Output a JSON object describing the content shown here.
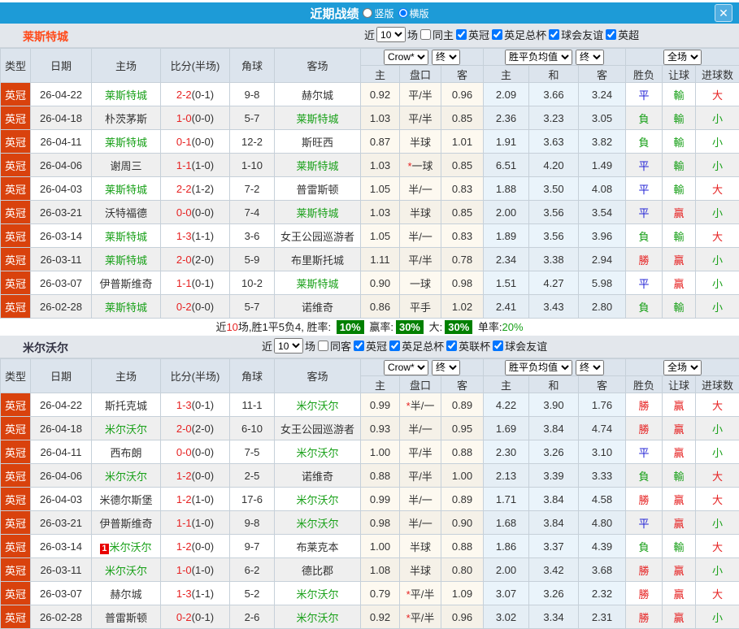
{
  "titlebar": {
    "title": "近期战绩",
    "radio_options": [
      {
        "label": "竖版",
        "selected": false
      },
      {
        "label": "横版",
        "selected": true
      }
    ],
    "close_glyph": "✕"
  },
  "table_header": {
    "type": "类型",
    "date": "日期",
    "home": "主场",
    "score": "比分(半场)",
    "corner": "角球",
    "away": "客场",
    "dd_company": "Crow*",
    "dd_final": "终",
    "dd_avg": "胜平负均值",
    "dd_final2": "终",
    "dd_scope": "全场",
    "sub_home": "主",
    "sub_handicap": "盘口",
    "sub_away": "客",
    "sub_win": "主",
    "sub_draw": "和",
    "sub_lose": "客",
    "sub_wl": "胜负",
    "sub_let": "让球",
    "sub_goals": "进球数"
  },
  "colors": {
    "red": "#e62222",
    "blue": "#2323d6",
    "green": "#18a018",
    "team_green": "#18a018",
    "league_badge_bg": "#d9420d",
    "title_bg": "#1d9bd7",
    "badge_green_bg": "#008000"
  },
  "result_map": {
    "勝": "red",
    "平": "blue",
    "負": "green",
    "贏": "red",
    "輸": "green",
    "大": "red",
    "小": "green"
  },
  "sections": [
    {
      "team": "莱斯特城",
      "team_color": "#ff4a1a",
      "filter": {
        "near": "近",
        "count": "10",
        "games": "场",
        "same": "同主",
        "same_checked": false,
        "leagues": [
          "英冠",
          "英足总杯",
          "球会友谊",
          "英超"
        ],
        "leagues_checked": [
          true,
          true,
          true,
          true
        ]
      },
      "rows": [
        {
          "lg": "英冠",
          "dt": "26-04-22",
          "hm": "莱斯特城",
          "hg": true,
          "sc": "2-2",
          "hf": "(0-1)",
          "cn": "9-8",
          "aw": "赫尔城",
          "ag": false,
          "o1": "0.92",
          "st": false,
          "hc": "平/半",
          "o2": "0.96",
          "ow": "2.09",
          "od": "3.66",
          "ol": "3.24",
          "r1": "平",
          "r2": "輸",
          "r3": "大"
        },
        {
          "lg": "英冠",
          "dt": "26-04-18",
          "hm": "朴茨茅斯",
          "hg": false,
          "sc": "1-0",
          "hf": "(0-0)",
          "cn": "5-7",
          "aw": "莱斯特城",
          "ag": true,
          "o1": "1.03",
          "st": false,
          "hc": "平/半",
          "o2": "0.85",
          "ow": "2.36",
          "od": "3.23",
          "ol": "3.05",
          "r1": "負",
          "r2": "輸",
          "r3": "小"
        },
        {
          "lg": "英冠",
          "dt": "26-04-11",
          "hm": "莱斯特城",
          "hg": true,
          "sc": "0-1",
          "hf": "(0-0)",
          "cn": "12-2",
          "aw": "斯旺西",
          "ag": false,
          "o1": "0.87",
          "st": false,
          "hc": "半球",
          "o2": "1.01",
          "ow": "1.91",
          "od": "3.63",
          "ol": "3.82",
          "r1": "負",
          "r2": "輸",
          "r3": "小"
        },
        {
          "lg": "英冠",
          "dt": "26-04-06",
          "hm": "谢周三",
          "hg": false,
          "sc": "1-1",
          "hf": "(1-0)",
          "cn": "1-10",
          "aw": "莱斯特城",
          "ag": true,
          "o1": "1.03",
          "st": true,
          "hc": "一球",
          "o2": "0.85",
          "ow": "6.51",
          "od": "4.20",
          "ol": "1.49",
          "r1": "平",
          "r2": "輸",
          "r3": "小"
        },
        {
          "lg": "英冠",
          "dt": "26-04-03",
          "hm": "莱斯特城",
          "hg": true,
          "sc": "2-2",
          "hf": "(1-2)",
          "cn": "7-2",
          "aw": "普雷斯顿",
          "ag": false,
          "o1": "1.05",
          "st": false,
          "hc": "半/一",
          "o2": "0.83",
          "ow": "1.88",
          "od": "3.50",
          "ol": "4.08",
          "r1": "平",
          "r2": "輸",
          "r3": "大"
        },
        {
          "lg": "英冠",
          "dt": "26-03-21",
          "hm": "沃特福德",
          "hg": false,
          "sc": "0-0",
          "hf": "(0-0)",
          "cn": "7-4",
          "aw": "莱斯特城",
          "ag": true,
          "o1": "1.03",
          "st": false,
          "hc": "半球",
          "o2": "0.85",
          "ow": "2.00",
          "od": "3.56",
          "ol": "3.54",
          "r1": "平",
          "r2": "贏",
          "r3": "小"
        },
        {
          "lg": "英冠",
          "dt": "26-03-14",
          "hm": "莱斯特城",
          "hg": true,
          "sc": "1-3",
          "hf": "(1-1)",
          "cn": "3-6",
          "aw": "女王公园巡游者",
          "ag": false,
          "o1": "1.05",
          "st": false,
          "hc": "半/一",
          "o2": "0.83",
          "ow": "1.89",
          "od": "3.56",
          "ol": "3.96",
          "r1": "負",
          "r2": "輸",
          "r3": "大"
        },
        {
          "lg": "英冠",
          "dt": "26-03-11",
          "hm": "莱斯特城",
          "hg": true,
          "sc": "2-0",
          "hf": "(2-0)",
          "cn": "5-9",
          "aw": "布里斯托城",
          "ag": false,
          "o1": "1.11",
          "st": false,
          "hc": "平/半",
          "o2": "0.78",
          "ow": "2.34",
          "od": "3.38",
          "ol": "2.94",
          "r1": "勝",
          "r2": "贏",
          "r3": "小"
        },
        {
          "lg": "英冠",
          "dt": "26-03-07",
          "hm": "伊普斯维奇",
          "hg": false,
          "sc": "1-1",
          "hf": "(0-1)",
          "cn": "10-2",
          "aw": "莱斯特城",
          "ag": true,
          "o1": "0.90",
          "st": false,
          "hc": "一球",
          "o2": "0.98",
          "ow": "1.51",
          "od": "4.27",
          "ol": "5.98",
          "r1": "平",
          "r2": "贏",
          "r3": "小"
        },
        {
          "lg": "英冠",
          "dt": "26-02-28",
          "hm": "莱斯特城",
          "hg": true,
          "sc": "0-2",
          "hf": "(0-0)",
          "cn": "5-7",
          "aw": "诺维奇",
          "ag": false,
          "o1": "0.86",
          "st": false,
          "hc": "平手",
          "o2": "1.02",
          "ow": "2.41",
          "od": "3.43",
          "ol": "2.80",
          "r1": "負",
          "r2": "輸",
          "r3": "小"
        }
      ],
      "summary": {
        "near": "近",
        "n": "10",
        "text1": "场,胜1平5负4, 胜率:",
        "winrate": "10%",
        "mid1": "赢率:",
        "rate2": "30%",
        "mid2": "大:",
        "rate3": "30%",
        "tail": "单率:",
        "single": "20%"
      }
    },
    {
      "team": "米尔沃尔",
      "team_color": "#333344",
      "filter": {
        "near": "近",
        "count": "10",
        "games": "场",
        "same": "同客",
        "same_checked": false,
        "leagues": [
          "英冠",
          "英足总杯",
          "英联杯",
          "球会友谊"
        ],
        "leagues_checked": [
          true,
          true,
          true,
          true
        ]
      },
      "rows": [
        {
          "lg": "英冠",
          "dt": "26-04-22",
          "hm": "斯托克城",
          "hg": false,
          "sc": "1-3",
          "hf": "(0-1)",
          "cn": "11-1",
          "aw": "米尔沃尔",
          "ag": true,
          "o1": "0.99",
          "st": true,
          "hc": "半/一",
          "o2": "0.89",
          "ow": "4.22",
          "od": "3.90",
          "ol": "1.76",
          "r1": "勝",
          "r2": "贏",
          "r3": "大"
        },
        {
          "lg": "英冠",
          "dt": "26-04-18",
          "hm": "米尔沃尔",
          "hg": true,
          "sc": "2-0",
          "hf": "(2-0)",
          "cn": "6-10",
          "aw": "女王公园巡游者",
          "ag": false,
          "o1": "0.93",
          "st": false,
          "hc": "半/一",
          "o2": "0.95",
          "ow": "1.69",
          "od": "3.84",
          "ol": "4.74",
          "r1": "勝",
          "r2": "贏",
          "r3": "小"
        },
        {
          "lg": "英冠",
          "dt": "26-04-11",
          "hm": "西布朗",
          "hg": false,
          "sc": "0-0",
          "hf": "(0-0)",
          "cn": "7-5",
          "aw": "米尔沃尔",
          "ag": true,
          "o1": "1.00",
          "st": false,
          "hc": "平/半",
          "o2": "0.88",
          "ow": "2.30",
          "od": "3.26",
          "ol": "3.10",
          "r1": "平",
          "r2": "贏",
          "r3": "小"
        },
        {
          "lg": "英冠",
          "dt": "26-04-06",
          "hm": "米尔沃尔",
          "hg": true,
          "sc": "1-2",
          "hf": "(0-0)",
          "cn": "2-5",
          "aw": "诺维奇",
          "ag": false,
          "o1": "0.88",
          "st": false,
          "hc": "平/半",
          "o2": "1.00",
          "ow": "2.13",
          "od": "3.39",
          "ol": "3.33",
          "r1": "負",
          "r2": "輸",
          "r3": "大"
        },
        {
          "lg": "英冠",
          "dt": "26-04-03",
          "hm": "米德尔斯堡",
          "hg": false,
          "sc": "1-2",
          "hf": "(1-0)",
          "cn": "17-6",
          "aw": "米尔沃尔",
          "ag": true,
          "o1": "0.99",
          "st": false,
          "hc": "半/一",
          "o2": "0.89",
          "ow": "1.71",
          "od": "3.84",
          "ol": "4.58",
          "r1": "勝",
          "r2": "贏",
          "r3": "大"
        },
        {
          "lg": "英冠",
          "dt": "26-03-21",
          "hm": "伊普斯维奇",
          "hg": false,
          "sc": "1-1",
          "hf": "(1-0)",
          "cn": "9-8",
          "aw": "米尔沃尔",
          "ag": true,
          "o1": "0.98",
          "st": false,
          "hc": "半/一",
          "o2": "0.90",
          "ow": "1.68",
          "od": "3.84",
          "ol": "4.80",
          "r1": "平",
          "r2": "贏",
          "r3": "小"
        },
        {
          "lg": "英冠",
          "dt": "26-03-14",
          "hm": "米尔沃尔",
          "hg": true,
          "bd": "1",
          "sc": "1-2",
          "hf": "(0-0)",
          "cn": "9-7",
          "aw": "布莱克本",
          "ag": false,
          "o1": "1.00",
          "st": false,
          "hc": "半球",
          "o2": "0.88",
          "ow": "1.86",
          "od": "3.37",
          "ol": "4.39",
          "r1": "負",
          "r2": "輸",
          "r3": "大"
        },
        {
          "lg": "英冠",
          "dt": "26-03-11",
          "hm": "米尔沃尔",
          "hg": true,
          "sc": "1-0",
          "hf": "(1-0)",
          "cn": "6-2",
          "aw": "德比郡",
          "ag": false,
          "o1": "1.08",
          "st": false,
          "hc": "半球",
          "o2": "0.80",
          "ow": "2.00",
          "od": "3.42",
          "ol": "3.68",
          "r1": "勝",
          "r2": "贏",
          "r3": "小"
        },
        {
          "lg": "英冠",
          "dt": "26-03-07",
          "hm": "赫尔城",
          "hg": false,
          "sc": "1-3",
          "hf": "(1-1)",
          "cn": "5-2",
          "aw": "米尔沃尔",
          "ag": true,
          "o1": "0.79",
          "st": true,
          "hc": "平/半",
          "o2": "1.09",
          "ow": "3.07",
          "od": "3.26",
          "ol": "2.32",
          "r1": "勝",
          "r2": "贏",
          "r3": "大"
        },
        {
          "lg": "英冠",
          "dt": "26-02-28",
          "hm": "普雷斯顿",
          "hg": false,
          "sc": "0-2",
          "hf": "(0-1)",
          "cn": "2-6",
          "aw": "米尔沃尔",
          "ag": true,
          "o1": "0.92",
          "st": true,
          "hc": "平/半",
          "o2": "0.96",
          "ow": "3.02",
          "od": "3.34",
          "ol": "2.31",
          "r1": "勝",
          "r2": "贏",
          "r3": "小"
        }
      ]
    }
  ]
}
